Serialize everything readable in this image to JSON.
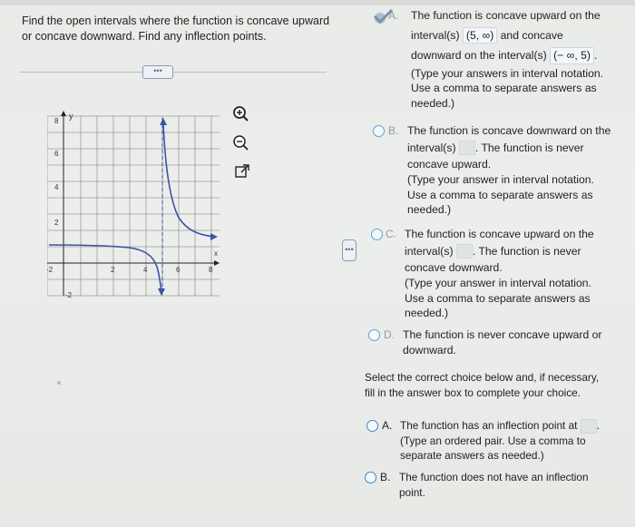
{
  "question": {
    "text": "Find the open intervals where the function is concave upward or concave downward. Find any inflection points."
  },
  "more_button": "•••",
  "separator_button": "•••",
  "graph": {
    "y_label": "y",
    "x_label": "x",
    "y_ticks": [
      "8",
      "6",
      "4",
      "2",
      "-2"
    ],
    "x_ticks": [
      "-2",
      "2",
      "4",
      "6",
      "8"
    ]
  },
  "tools": [
    "zoom-in-icon",
    "zoom-out-icon",
    "external-link-icon"
  ],
  "part1": {
    "A": {
      "letter": "A.",
      "line1": "The function is concave upward on the",
      "line2_pre": "interval(s)",
      "interval_up": "(5, ∞)",
      "line2_post": "and concave",
      "line3_pre": "downward on the interval(s)",
      "interval_down": "(− ∞, 5)",
      "line3_post": ".",
      "hint1": "(Type your answers in interval notation.",
      "hint2": "Use a comma to separate answers as",
      "hint3": "needed.)"
    },
    "B": {
      "letter": "B.",
      "line1": "The function is concave downward on the",
      "line2_pre": "interval(s)",
      "line2_post": ". The function is never",
      "line3": "concave upward.",
      "hint1": "(Type your answer in interval notation.",
      "hint2": "Use a comma to separate answers as",
      "hint3": "needed.)"
    },
    "C": {
      "letter": "C.",
      "line1": "The function is concave upward on the",
      "line2_pre": "interval(s)",
      "line2_post": ". The function is never",
      "line3": "concave downward.",
      "hint1": "(Type your answer in interval notation.",
      "hint2": "Use a comma to separate answers as",
      "hint3": "needed.)"
    },
    "D": {
      "letter": "D.",
      "line1": "The function is never concave upward or",
      "line2": "downward."
    }
  },
  "part2": {
    "prompt1": "Select the correct choice below and, if necessary,",
    "prompt2": "fill in the answer box to complete your choice.",
    "A": {
      "letter": "A.",
      "line1": "The function has an inflection point at",
      "hint1": "(Type an ordered pair. Use a comma to",
      "hint2": "separate answers as needed.)"
    },
    "B": {
      "letter": "B.",
      "line1": "The function does not have an inflection",
      "line2": "point."
    }
  },
  "colors": {
    "curve": "#3a54a8",
    "radio": "#5aa0d8",
    "check": "#8fa8c0"
  }
}
